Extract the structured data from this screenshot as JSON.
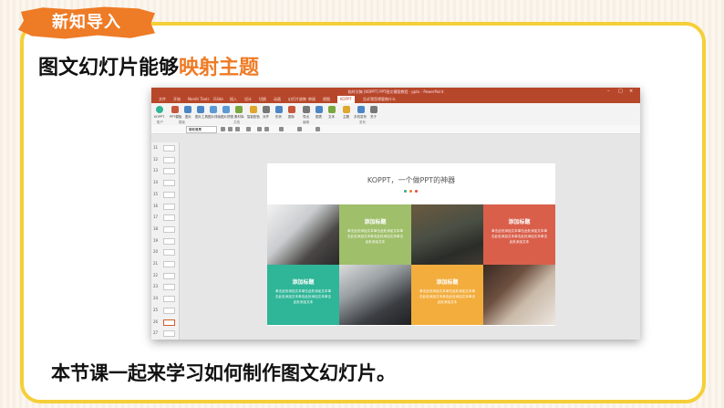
{
  "header": {
    "badge": "新知导入",
    "title_main": "图文幻灯片能够",
    "title_highlight": "映射主题"
  },
  "footer_text": "本节课一起来学习如何制作图文幻灯片。",
  "app": {
    "window_title": "临时文稿 [KOPPT] PPT图文模版教程 - pptx - PowerPoint",
    "tabs": [
      "文件",
      "开始",
      "Nordri Tools",
      "iSlide",
      "插入",
      "设计",
      "切换",
      "动画",
      "幻灯片放映",
      "审阅",
      "视图",
      "KOPPT"
    ],
    "active_tab": "KOPPT",
    "tab_right": "告诉我您想要做什么",
    "ribbon_labels": [
      "KOPPT",
      "PPT模板",
      "图片",
      "图片工具",
      "图片排版",
      "图片拼图",
      "素材库",
      "智能配色",
      "对齐",
      "形状",
      "图标",
      "导出",
      "图表",
      "文本",
      "主题",
      "手机发布",
      "关于"
    ],
    "group_labels": [
      "账户",
      "模板",
      "文档",
      "编辑",
      "发布"
    ],
    "font_field": "微软雅黑",
    "slide_numbers": [
      "11",
      "12",
      "13",
      "14",
      "15",
      "16",
      "17",
      "18",
      "19",
      "20",
      "21",
      "22",
      "23",
      "24",
      "25",
      "26",
      "27"
    ],
    "slide": {
      "title": "KOPPT，一个做PPT的神器",
      "dot_colors": [
        "#3aa88f",
        "#ee7b25",
        "#e84a3a"
      ],
      "cells": [
        {
          "title": "添加标题",
          "body": "单击此处添加文本单击此处添加文本单击此处添加文本单击此处添加文本单击此处添加文本",
          "color": "#9fbf6a"
        },
        {
          "title": "添加标题",
          "body": "单击此处添加文本单击此处添加文本单击此处添加文本单击此处添加文本单击此处添加文本",
          "color": "#d95f4b"
        },
        {
          "title": "添加标题",
          "body": "单击此处添加文本单击此处添加文本单击此处添加文本单击此处添加文本单击此处添加文本",
          "color": "#2fb597"
        },
        {
          "title": "添加标题",
          "body": "单击此处添加文本单击此处添加文本单击此处添加文本单击此处添加文本单击此处添加文本",
          "color": "#f3ad3d"
        }
      ]
    }
  },
  "colors": {
    "border": "#f5cf39",
    "accent": "#ee7b25",
    "ppt_red": "#b7472a"
  }
}
